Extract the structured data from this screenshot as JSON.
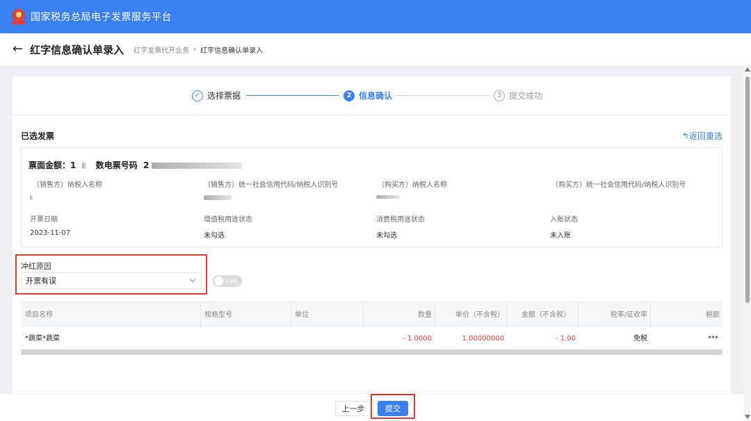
{
  "app": {
    "title": "国家税务总局电子发票服务平台"
  },
  "header": {
    "back_glyph": "←",
    "page_title": "红字信息确认单录入",
    "breadcrumb": [
      "红字发票代开业务",
      "红字信息确认单录入"
    ],
    "separator": "›"
  },
  "steps": [
    {
      "num": "✓",
      "label": "选择票据",
      "state": "done"
    },
    {
      "num": "2",
      "label": "信息确认",
      "state": "active"
    },
    {
      "num": "3",
      "label": "提交成功",
      "state": "pending"
    }
  ],
  "section": {
    "title": "已选发票",
    "return_label": "返回重选",
    "return_icon": "↰"
  },
  "invoice": {
    "amount_label": "票面金额：1",
    "number_label": "数电票号码",
    "number_prefix": "2",
    "fields_row1": [
      {
        "label": "（销售方）纳税人名称",
        "value": ""
      },
      {
        "label": "（销售方）统一社会信用代码/纳税人识别号",
        "value": ""
      },
      {
        "label": "（购买方）纳税人名称",
        "value": ""
      },
      {
        "label": "（购买方）统一社会信用代码/纳税人识别号",
        "value": ""
      }
    ],
    "fields_row2": [
      {
        "label": "开票日期",
        "value": "2023-11-07"
      },
      {
        "label": "增值税用途状态",
        "value": "未勾选"
      },
      {
        "label": "消费税用途状态",
        "value": "未勾选"
      },
      {
        "label": "入账状态",
        "value": "未入账"
      }
    ]
  },
  "reason": {
    "label": "冲红原因",
    "selected": "开票有误"
  },
  "toggle": {
    "text": "不含税",
    "on": false
  },
  "table": {
    "headers": [
      "项目名称",
      "规格型号",
      "单位",
      "数量",
      "单价（不含税）",
      "金额（不含税）",
      "税率/征收率",
      "税额"
    ],
    "rows": [
      [
        "*蔬菜*蔬菜",
        "",
        "",
        "- 1.0000",
        "1.00000000",
        "- 1.00",
        "免税",
        "***"
      ]
    ]
  },
  "footer": {
    "prev_label": "上一步",
    "submit_label": "提交"
  },
  "colors": {
    "brand": "#3a80f0",
    "highlight": "#e23a2e",
    "negative": "#e23a2e"
  }
}
